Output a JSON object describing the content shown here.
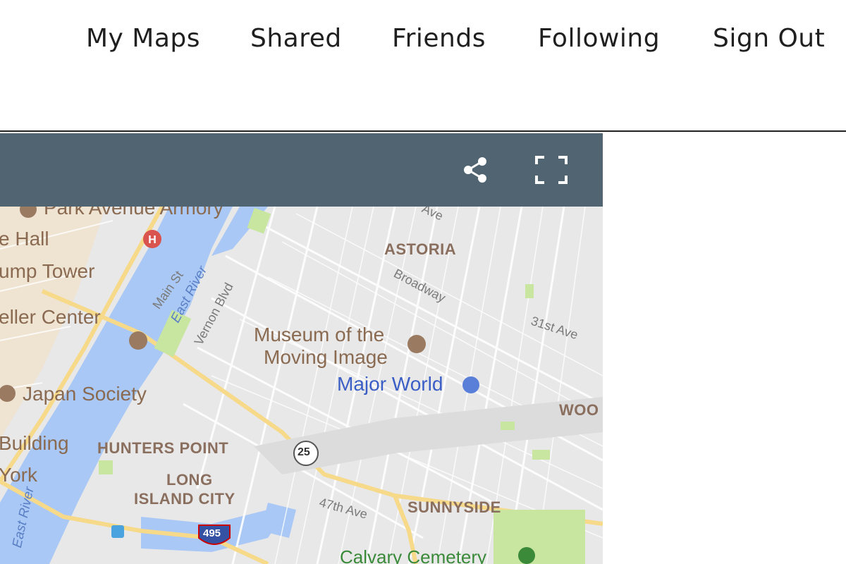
{
  "nav": {
    "items": [
      {
        "label": "My Maps"
      },
      {
        "label": "Shared"
      },
      {
        "label": "Friends"
      },
      {
        "label": "Following"
      },
      {
        "label": "Sign Out"
      }
    ]
  },
  "toolbar": {
    "color": "#506471",
    "share_icon": "share-icon",
    "fullscreen_icon": "fullscreen-icon"
  },
  "map": {
    "places": {
      "park_avenue_armory": "Park Avenue Armory",
      "hall": "e Hall",
      "trump_tower": "ump Tower",
      "rockefeller_center": "eller Center",
      "japan_society": "Japan Society",
      "building": "Building",
      "york": "York",
      "museum_line1": "Museum of the",
      "museum_line2": "Moving Image",
      "major_world": "Major World",
      "calvary_cemetery": "Calvary Cemetery"
    },
    "neighborhoods": {
      "astoria": "ASTORIA",
      "hunters_point": "HUNTERS POINT",
      "long": "LONG",
      "island_city": "ISLAND CITY",
      "sunnyside": "SUNNYSIDE",
      "woodside": "WOO"
    },
    "streets": {
      "ave_top": "Ave",
      "broadway": "Broadway",
      "31st_ave": "31st Ave",
      "main_st": "Main St",
      "vernon_blvd": "Vernon Blvd",
      "47th_ave": "47th Ave"
    },
    "rivers": {
      "east_river": "East River",
      "east_river_lower": "East River"
    },
    "shields": {
      "route_25": "25",
      "interstate_495": "495"
    },
    "colors": {
      "water": "#a9c8f5",
      "land": "#e8e8e8",
      "highway": "#f7d98a",
      "park": "#c8e6a0",
      "poi_brown": "#8a6a50",
      "hospital_red": "#d9534f"
    }
  }
}
